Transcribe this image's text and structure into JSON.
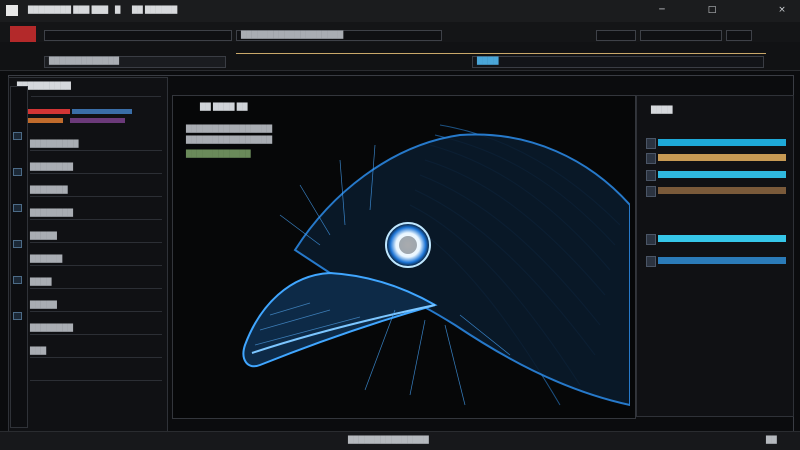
{
  "app": {
    "title": "████████ ███ ███"
  },
  "menu": {
    "items": [
      "████████████",
      "███",
      "█",
      "██ ██████"
    ]
  },
  "window_controls": {
    "min": "─",
    "max": "□",
    "close": "×"
  },
  "toolbar": {
    "doc_label": "███████████████████",
    "page_indicator": "D"
  },
  "options": {
    "label_a": "█████████████",
    "label_b": "████"
  },
  "left_panel": {
    "title": "██████████",
    "rows": [
      "█████████",
      "████████",
      "███████",
      "████████",
      "█████",
      "██████",
      "████",
      "█████",
      "████████",
      "███"
    ]
  },
  "canvas": {
    "header_1": "██ ████ ██",
    "header_2": "████████████████",
    "header_3": "████████████████",
    "header_4": "████████████"
  },
  "right_panel": {
    "title": "████",
    "layers": [
      {
        "color": "#1ea9d8"
      },
      {
        "color": "#c79a54"
      },
      {
        "color": "#2fb8df"
      },
      {
        "color": "#7a5a3a"
      },
      {
        "color": "#36c6e8"
      },
      {
        "color": "#2b7bb8"
      }
    ]
  },
  "status": {
    "center": "███████████████",
    "right": "██"
  },
  "colors": {
    "accent_red": "#b3292a",
    "accent_cyan": "#32c5ec",
    "artwork_blue": "#2f8fe8"
  },
  "icons": [
    "close-icon",
    "minimize-icon",
    "maximize-icon",
    "layer-icon"
  ]
}
